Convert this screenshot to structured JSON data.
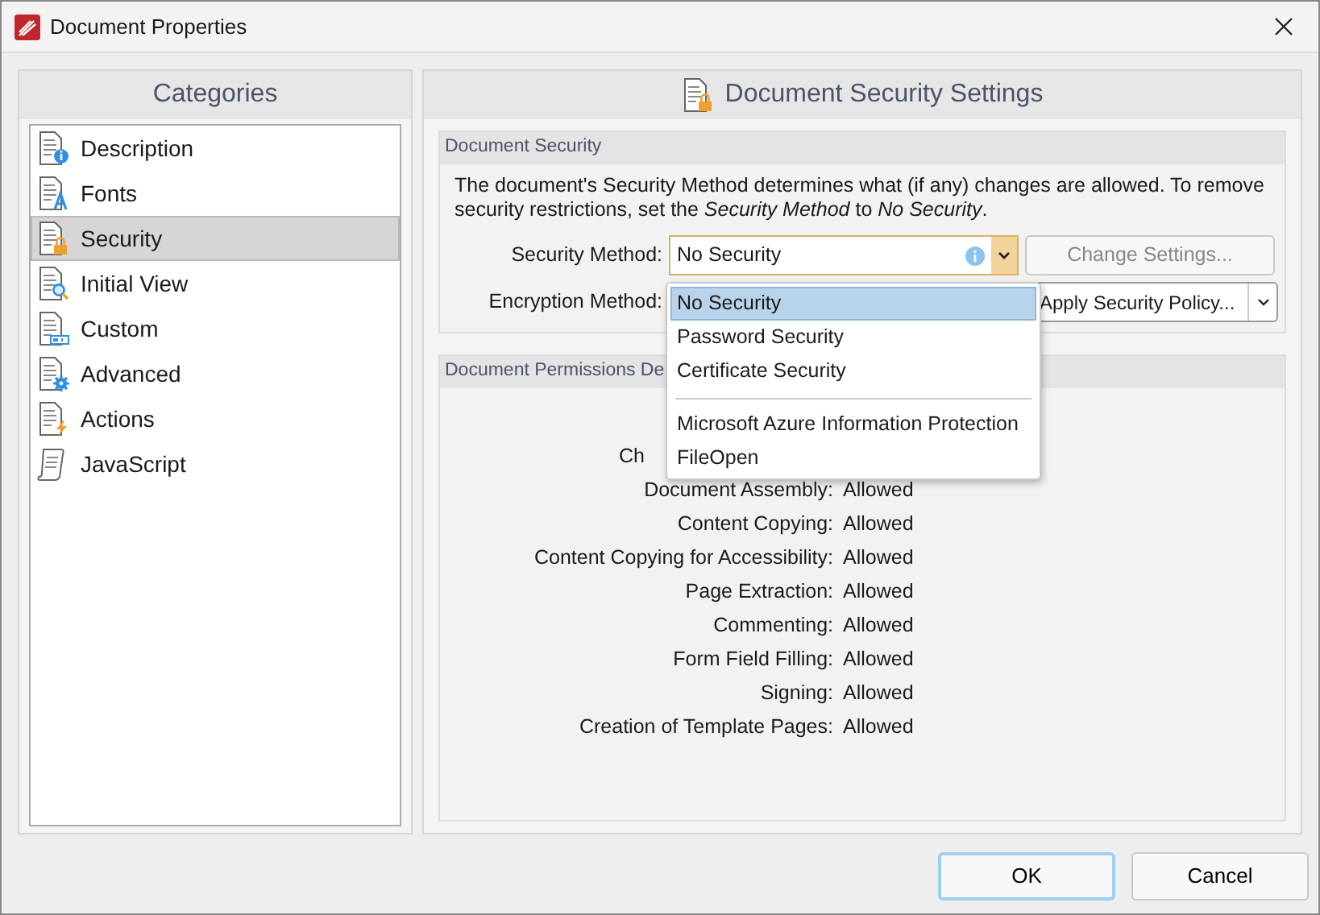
{
  "window": {
    "title": "Document Properties"
  },
  "sidebar": {
    "title": "Categories",
    "items": [
      {
        "label": "Description",
        "kind": "info",
        "selected": false
      },
      {
        "label": "Fonts",
        "kind": "font",
        "selected": false
      },
      {
        "label": "Security",
        "kind": "lock",
        "selected": true
      },
      {
        "label": "Initial View",
        "kind": "zoom",
        "selected": false
      },
      {
        "label": "Custom",
        "kind": "field",
        "selected": false
      },
      {
        "label": "Advanced",
        "kind": "gear",
        "selected": false
      },
      {
        "label": "Actions",
        "kind": "bolt",
        "selected": false
      },
      {
        "label": "JavaScript",
        "kind": "scroll",
        "selected": false
      }
    ]
  },
  "panel": {
    "title": "Document Security Settings",
    "security_group": {
      "title": "Document Security",
      "description": "The document's Security Method determines what (if any) changes are allowed. To remove security restrictions, set the *Security Method* to *No Security*.",
      "security_method": {
        "label": "Security Method:",
        "value": "No Security"
      },
      "encryption_method": {
        "label": "Encryption Method:"
      },
      "change_settings": {
        "label": "Change Settings...",
        "disabled": true
      },
      "apply_policy": {
        "label": "Apply Security Policy..."
      }
    },
    "dropdown": {
      "items": [
        {
          "label": "No Security",
          "selected": true
        },
        {
          "label": "Password Security",
          "selected": false
        },
        {
          "label": "Certificate Security",
          "selected": false
        },
        {
          "kind": "separator"
        },
        {
          "label": "Microsoft Azure Information Protection",
          "selected": false
        },
        {
          "label": "FileOpen",
          "selected": false
        }
      ]
    },
    "permissions_group": {
      "title": "Document Permissions De",
      "rows": [
        {
          "label": "Ch",
          "kind": "partial"
        },
        {
          "label": "Document Assembly:",
          "value": "Allowed"
        },
        {
          "label": "Content Copying:",
          "value": "Allowed"
        },
        {
          "label": "Content Copying for Accessibility:",
          "value": "Allowed"
        },
        {
          "label": "Page Extraction:",
          "value": "Allowed"
        },
        {
          "label": "Commenting:",
          "value": "Allowed"
        },
        {
          "label": "Form Field Filling:",
          "value": "Allowed"
        },
        {
          "label": "Signing:",
          "value": "Allowed"
        },
        {
          "label": "Creation of Template Pages:",
          "value": "Allowed"
        }
      ]
    }
  },
  "buttons": [
    {
      "label": "OK",
      "default": true
    },
    {
      "label": "Cancel",
      "default": false
    }
  ]
}
